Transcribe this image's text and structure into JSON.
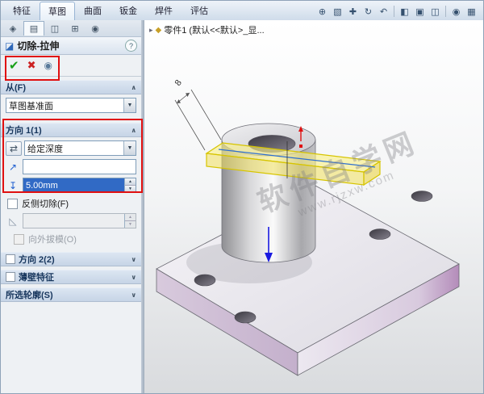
{
  "ribbon": {
    "tabs": [
      {
        "label": "特征"
      },
      {
        "label": "草图"
      },
      {
        "label": "曲面"
      },
      {
        "label": "钣金"
      },
      {
        "label": "焊件"
      },
      {
        "label": "评估"
      }
    ]
  },
  "panel": {
    "title": "切除-拉伸",
    "from_label": "从(F)",
    "from_value": "草图基准面",
    "dir1_label": "方向 1(1)",
    "dir1_end_condition": "给定深度",
    "dir1_depth": "5.00mm",
    "flip_side_label": "反侧切除(F)",
    "draft_outward_label": "向外拔模(O)",
    "dir2_label": "方向 2(2)",
    "thin_label": "薄壁特征",
    "contours_label": "所选轮廓(S)"
  },
  "viewport": {
    "tree_item": "零件1 (默认<<默认>_显...",
    "dimension_8": "8",
    "watermark_title": "软件自学网",
    "watermark_url": "www.rjzxw.com"
  },
  "icons": {
    "cut_extrude": "◪",
    "help": "?",
    "confirm": "✔",
    "cancel": "✖",
    "preview": "◉",
    "chevron_up": "∧",
    "chevron_down": "∨",
    "dropdown_arrow": "▼",
    "reverse_direction": "⇄",
    "direction_ref": "↗",
    "depth": "↧",
    "draft": "◺",
    "spin_up": "▲",
    "spin_down": "▼",
    "part": "◆",
    "expander": "▸",
    "pm_tab_1": "◈",
    "pm_tab_2": "▤",
    "pm_tab_3": "◫",
    "pm_tab_4": "⊞",
    "pm_tab_5": "◉",
    "zoom_fit": "⊕",
    "zoom_area": "▧",
    "pan": "✚",
    "rotate": "↻",
    "previous_view": "↶",
    "section": "◧",
    "orientation": "▣",
    "display_style": "◫",
    "hide_items": "◉",
    "scene": "▦"
  },
  "colors": {
    "annotation_red": "#e01010",
    "selection_blue": "#316ac5",
    "sketch_yellow": "#e8d400",
    "plate_mauve": "#bf9ec5",
    "confirm_green": "#18a018",
    "cancel_red": "#cc2222"
  }
}
